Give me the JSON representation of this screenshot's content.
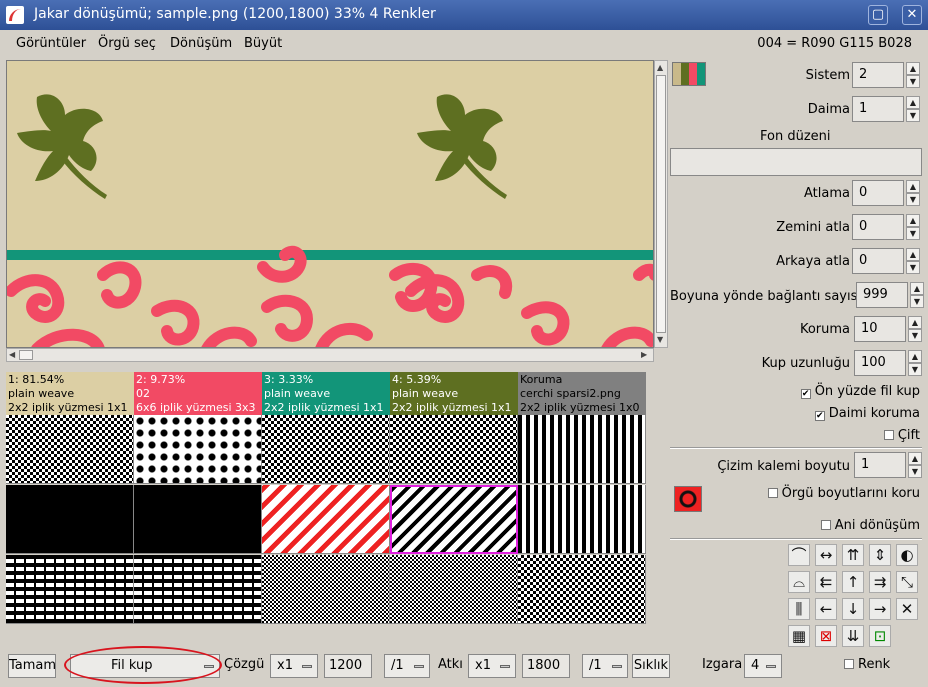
{
  "window": {
    "title": "Jakar dönüşümü; sample.png (1200,1800) 33% 4 Renkler",
    "buttons": [
      "maximize",
      "close"
    ]
  },
  "menu": {
    "items": [
      "Görüntüler",
      "Örgü seç",
      "Dönüşüm",
      "Büyüt"
    ],
    "color_readout": "004 = R090 G115 B028"
  },
  "image": {
    "colors": {
      "background": "#dccfa4",
      "leaf": "#5e6f21",
      "band": "#129579",
      "swirl": "#f24a64"
    }
  },
  "weave_columns": [
    {
      "line1": "1: 81.54%",
      "line2": "plain weave",
      "line3": "2x2 iplik yüzmesi 1x1",
      "color": "#dccfa4",
      "text_color": "#000000"
    },
    {
      "line1": "2: 9.73%",
      "line2": "02",
      "line3": "6x6 iplik yüzmesi 3x3",
      "color": "#f24a64",
      "text_color": "#ffffff"
    },
    {
      "line1": "3: 3.33%",
      "line2": "plain weave",
      "line3": "2x2 iplik yüzmesi 1x1",
      "color": "#129579",
      "text_color": "#ffffff"
    },
    {
      "line1": "4: 5.39%",
      "line2": "plain weave",
      "line3": "2x2 iplik yüzmesi 1x1",
      "color": "#5e6f21",
      "text_color": "#ffffff"
    },
    {
      "line1": "Koruma",
      "line2": "cerchi sparsi2.png",
      "line3": "2x2 iplik yüzmesi 1x0",
      "color": "#808080",
      "text_color": "#000000"
    }
  ],
  "right_panel": {
    "sistem": {
      "label": "Sistem",
      "value": "2"
    },
    "daima": {
      "label": "Daima",
      "value": "1"
    },
    "fon_duzeni": {
      "label": "Fon düzeni",
      "value": ""
    },
    "atlama": {
      "label": "Atlama",
      "value": "0"
    },
    "zemini_atla": {
      "label": "Zemini atla",
      "value": "0"
    },
    "arkaya_atla": {
      "label": "Arkaya atla",
      "value": "0"
    },
    "boyuna": {
      "label": "Boyuna yönde bağlantı sayısı",
      "value": "999"
    },
    "koruma": {
      "label": "Koruma",
      "value": "10"
    },
    "kup_uzunlugu": {
      "label": "Kup uzunluğu",
      "value": "100"
    },
    "on_yuzde": {
      "label": "Ön yüzde fil kup",
      "checked": true
    },
    "daimi_koruma": {
      "label": "Daimi koruma",
      "checked": true
    },
    "cift": {
      "label": "Çift",
      "checked": false
    },
    "cizim_kalemi": {
      "label": "Çizim kalemi boyutu",
      "value": "1"
    },
    "orgu_boyut": {
      "label": "Örgü boyutlarını koru",
      "checked": false
    },
    "ani_donusum": {
      "label": "Ani dönüşüm",
      "checked": false
    }
  },
  "toolbar_icons": [
    "stairs-up-icon",
    "expand-horizontal-icon",
    "double-up-icon",
    "expand-vertical-icon",
    "half-circle-icon",
    "stairs-down-icon",
    "double-left-icon",
    "up-arrow-icon",
    "double-right-icon",
    "diagonal-arrows-icon",
    "bars-icon",
    "left-arrow-icon",
    "down-arrow-icon",
    "right-arrow-icon",
    "cross-icon",
    "grid-icon",
    "red-cursor-icon",
    "double-down-icon",
    "green-cursor-icon"
  ],
  "bottom": {
    "tamam": "Tamam",
    "fil_kup": "Fil kup",
    "cozgu_label": "Çözgü",
    "cozgu_mult": "x1",
    "cozgu_value": "1200",
    "cozgu_div": "/1",
    "atki_label": "Atkı",
    "atki_mult": "x1",
    "atki_value": "1800",
    "atki_div": "/1",
    "siklik": "Sıklık",
    "izgara_label": "Izgara",
    "izgara_value": "4",
    "renk_label": "Renk",
    "renk_checked": false
  }
}
